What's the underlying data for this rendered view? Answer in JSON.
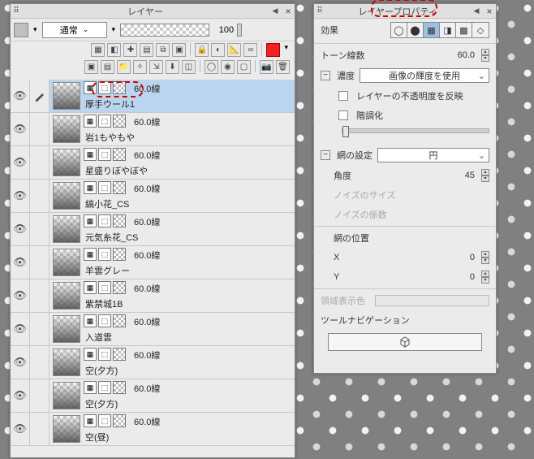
{
  "layers_panel": {
    "title": "レイヤー",
    "blend_mode": "通常",
    "opacity": "100",
    "layers": [
      {
        "line": "60.0線",
        "name": "厚手ウール1"
      },
      {
        "line": "60.0線",
        "name": "岩1もやもや"
      },
      {
        "line": "60.0線",
        "name": "星盛りぼやぼや"
      },
      {
        "line": "60.0線",
        "name": "縞小花_CS"
      },
      {
        "line": "60.0線",
        "name": "元気糸花_CS"
      },
      {
        "line": "60.0線",
        "name": "羊雲グレー"
      },
      {
        "line": "60.0線",
        "name": "紫禁城1B"
      },
      {
        "line": "60.0線",
        "name": "入道雲"
      },
      {
        "line": "60.0線",
        "name": "空(夕方)"
      },
      {
        "line": "60.0線",
        "name": "空(夕方)"
      },
      {
        "line": "60.0線",
        "name": "空(昼)"
      }
    ]
  },
  "prop_panel": {
    "title": "レイヤープロパティ",
    "section_effect": "効果",
    "tone_lines_label": "トーン線数",
    "tone_lines_value": "60.0",
    "density_label": "濃度",
    "density_select": "画像の輝度を使用",
    "reflect_opacity": "レイヤーの不透明度を反映",
    "gradation": "階調化",
    "net_setting": "網の設定",
    "net_shape": "円",
    "angle_label": "角度",
    "angle_value": "45",
    "noise_size": "ノイズのサイズ",
    "noise_coef": "ノイズの係数",
    "net_pos": "網の位置",
    "x_label": "X",
    "x_value": "0",
    "y_label": "Y",
    "y_value": "0",
    "area_color": "領域表示色",
    "tool_nav": "ツールナビゲーション"
  }
}
